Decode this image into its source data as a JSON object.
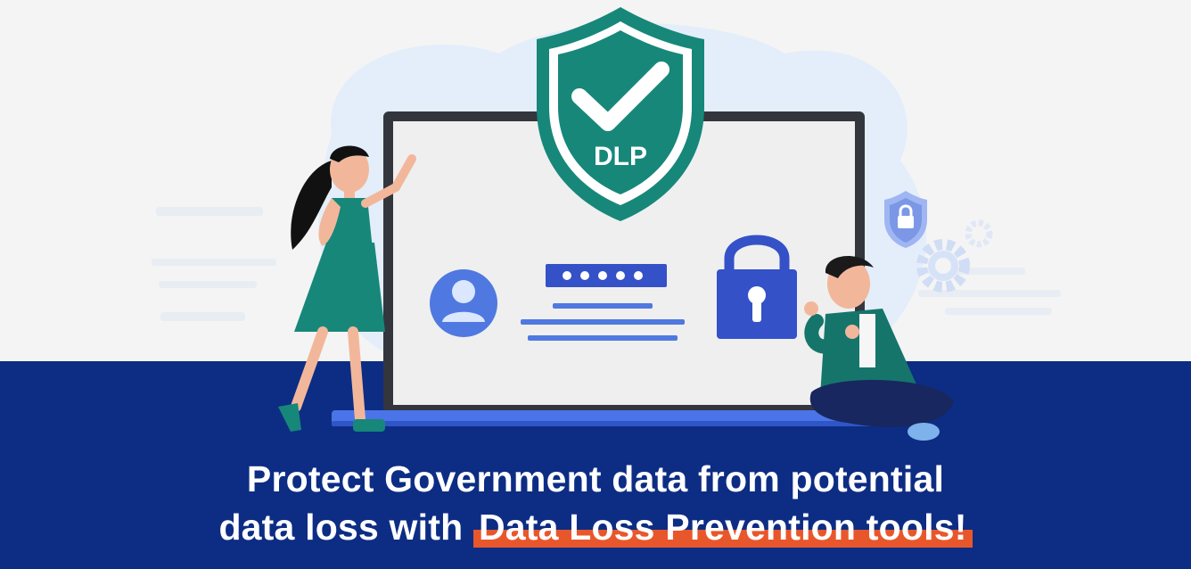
{
  "banner": {
    "badge_text": "DLP",
    "headline_line1": "Protect Government data from potential",
    "headline_line2_prefix": "data loss with ",
    "headline_line2_highlight": "Data Loss Prevention tools!"
  },
  "colors": {
    "background_top": "#f4f4f4",
    "background_bottom": "#0d2d84",
    "shield": "#17877a",
    "accent_blue": "#3b5fd6",
    "highlight": "#e8572c",
    "text": "#ffffff"
  },
  "icons": [
    "shield-check-icon",
    "user-avatar-icon",
    "password-field-icon",
    "padlock-icon",
    "small-shield-lock-icon",
    "gear-icon"
  ]
}
